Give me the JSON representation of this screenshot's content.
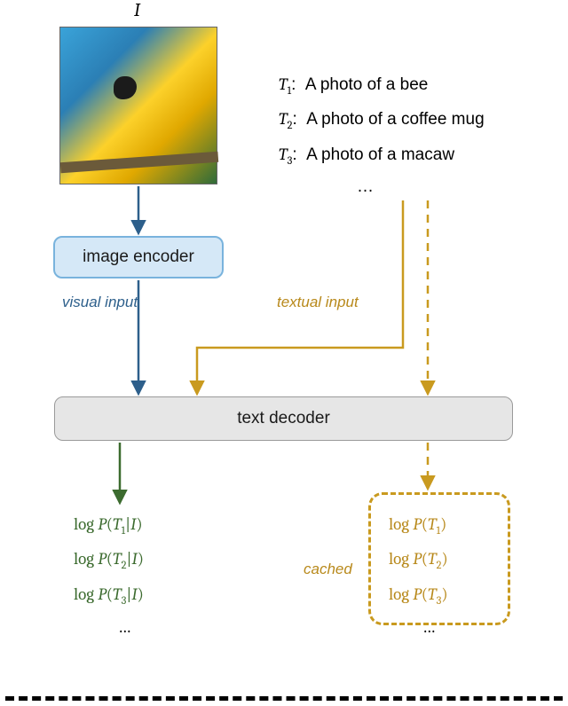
{
  "labels": {
    "I": "I",
    "visual_input": "visual input",
    "textual_input": "textual input",
    "cached": "cached"
  },
  "prompts": {
    "items": [
      {
        "tag": "T",
        "sub": "1",
        "sep": ":",
        "text": "A photo of a bee"
      },
      {
        "tag": "T",
        "sub": "2",
        "sep": ":",
        "text": "A photo of a coffee mug"
      },
      {
        "tag": "T",
        "sub": "3",
        "sep": ":",
        "text": "A photo of a macaw"
      }
    ],
    "ellipsis": "…"
  },
  "blocks": {
    "image_encoder": "image encoder",
    "text_decoder": "text decoder"
  },
  "outputs": {
    "conditional": [
      {
        "fn": "log",
        "P": "P",
        "arg_t": "T",
        "arg_sub": "1",
        "given": "|",
        "cond": "I"
      },
      {
        "fn": "log",
        "P": "P",
        "arg_t": "T",
        "arg_sub": "2",
        "given": "|",
        "cond": "I"
      },
      {
        "fn": "log",
        "P": "P",
        "arg_t": "T",
        "arg_sub": "3",
        "given": "|",
        "cond": "I"
      }
    ],
    "prior": [
      {
        "fn": "log",
        "P": "P",
        "arg_t": "T",
        "arg_sub": "1"
      },
      {
        "fn": "log",
        "P": "P",
        "arg_t": "T",
        "arg_sub": "2"
      },
      {
        "fn": "log",
        "P": "P",
        "arg_t": "T",
        "arg_sub": "3"
      }
    ],
    "ellipsis": "…"
  },
  "colors": {
    "blue_arrow": "#2d5f8b",
    "gold_arrow": "#c99a1f",
    "green_arrow": "#3c6b2f",
    "encoder_fill": "#d5e8f7",
    "encoder_stroke": "#79b3dd",
    "decoder_fill": "#e6e6e6",
    "decoder_stroke": "#9a9a9a"
  }
}
